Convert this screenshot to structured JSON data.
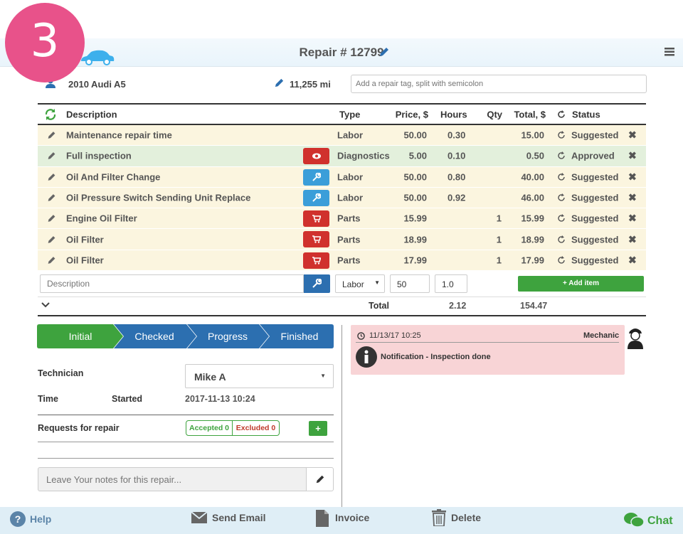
{
  "step_badge": "3",
  "header": {
    "title": "Repair # 12799"
  },
  "vehicle": {
    "name": "2010 Audi A5",
    "mileage": "11,255 mi",
    "tag_placeholder": "Add a repair tag, split with semicolon"
  },
  "table": {
    "headers": {
      "description": "Description",
      "type": "Type",
      "price": "Price, $",
      "hours": "Hours",
      "qty": "Qty",
      "total": "Total, $",
      "status": "Status"
    },
    "rows": [
      {
        "description": "Maintenance repair time",
        "type": "Labor",
        "price": "50.00",
        "hours": "0.30",
        "qty": "",
        "total": "15.00",
        "status": "Suggested",
        "style": "sug",
        "btn": ""
      },
      {
        "description": "Full inspection",
        "type": "Diagnostics",
        "price": "5.00",
        "hours": "0.10",
        "qty": "",
        "total": "0.50",
        "status": "Approved",
        "style": "app",
        "btn": "eye"
      },
      {
        "description": "Oil And Filter Change",
        "type": "Labor",
        "price": "50.00",
        "hours": "0.80",
        "qty": "",
        "total": "40.00",
        "status": "Suggested",
        "style": "sug",
        "btn": "wrench"
      },
      {
        "description": "Oil Pressure Switch Sending Unit Replace",
        "type": "Labor",
        "price": "50.00",
        "hours": "0.92",
        "qty": "",
        "total": "46.00",
        "status": "Suggested",
        "style": "sug",
        "btn": "wrench"
      },
      {
        "description": "Engine Oil Filter",
        "type": "Parts",
        "price": "15.99",
        "hours": "",
        "qty": "1",
        "total": "15.99",
        "status": "Suggested",
        "style": "sug",
        "btn": "cart"
      },
      {
        "description": "Oil Filter",
        "type": "Parts",
        "price": "18.99",
        "hours": "",
        "qty": "1",
        "total": "18.99",
        "status": "Suggested",
        "style": "sug",
        "btn": "cart"
      },
      {
        "description": "Oil Filter",
        "type": "Parts",
        "price": "17.99",
        "hours": "",
        "qty": "1",
        "total": "17.99",
        "status": "Suggested",
        "style": "sug",
        "btn": "cart"
      }
    ],
    "new_item": {
      "description_placeholder": "Description",
      "type": "Labor",
      "price": "50",
      "qty": "1.0",
      "add_label": "+ Add item"
    },
    "totals": {
      "label": "Total",
      "hours": "2.12",
      "total": "154.47"
    }
  },
  "tabs": [
    "Initial",
    "Checked",
    "Progress",
    "Finished"
  ],
  "details": {
    "technician_label": "Technician",
    "technician": "Mike A",
    "time_label": "Time",
    "started_label": "Started",
    "started_value": "2017-11-13 10:24",
    "requests_label": "Requests for repair",
    "accepted": "Accepted 0",
    "excluded": "Excluded 0",
    "notes_placeholder": "Leave Your notes for this repair..."
  },
  "notification": {
    "time": "11/13/17 10:25",
    "role": "Mechanic",
    "text": "Notification - Inspection done"
  },
  "bottom": {
    "help": "Help",
    "send_email": "Send Email",
    "invoice": "Invoice",
    "delete": "Delete",
    "chat": "Chat"
  },
  "colors": {
    "badge": "#e8528a",
    "green": "#3ea33e",
    "blue": "#2c6fb0",
    "red": "#d0312d",
    "notification_bg": "#f8d4d6"
  }
}
